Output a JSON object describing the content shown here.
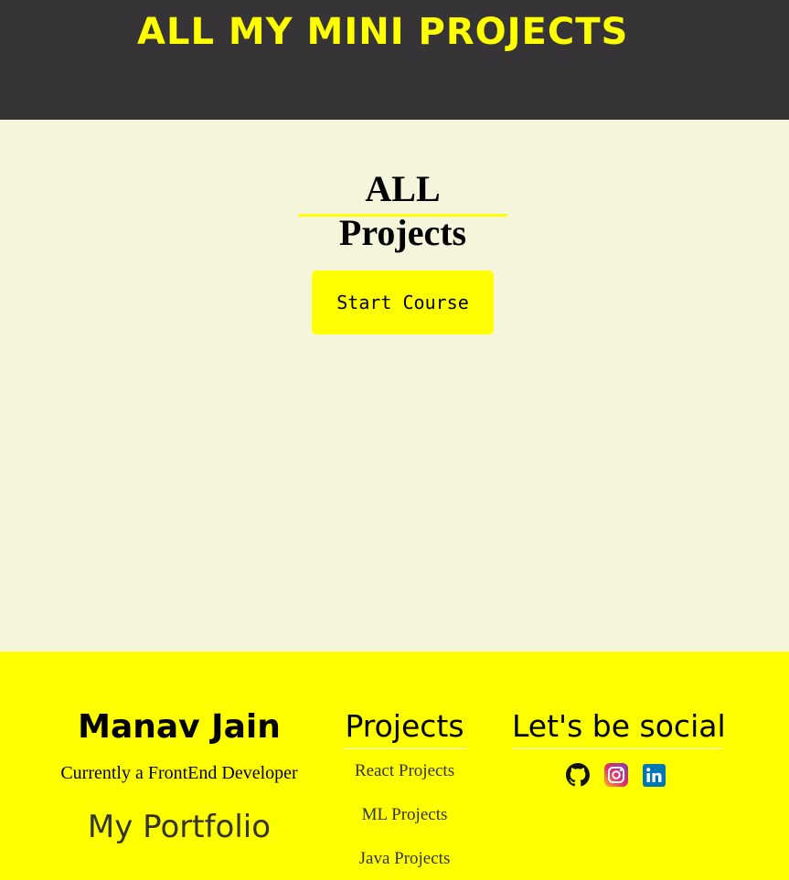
{
  "header": {
    "title": "ALL MY MINI PROJECTS"
  },
  "main": {
    "section_title": "ALL Projects",
    "start_button_label": "Start Course"
  },
  "footer": {
    "name": "Manav Jain",
    "role": "Currently a FrontEnd Developer",
    "portfolio_label": "My Portfolio",
    "projects_heading": "Projects",
    "project_links": [
      "React Projects",
      "ML Projects",
      "Java Projects"
    ],
    "social_heading": "Let's be social",
    "social_icons": [
      "github-icon",
      "instagram-icon",
      "linkedin-icon"
    ]
  },
  "colors": {
    "header_bg": "#363436",
    "accent_yellow": "#ffff00",
    "page_bg": "#f5f5dc",
    "linkedin_blue": "#0077b5"
  }
}
